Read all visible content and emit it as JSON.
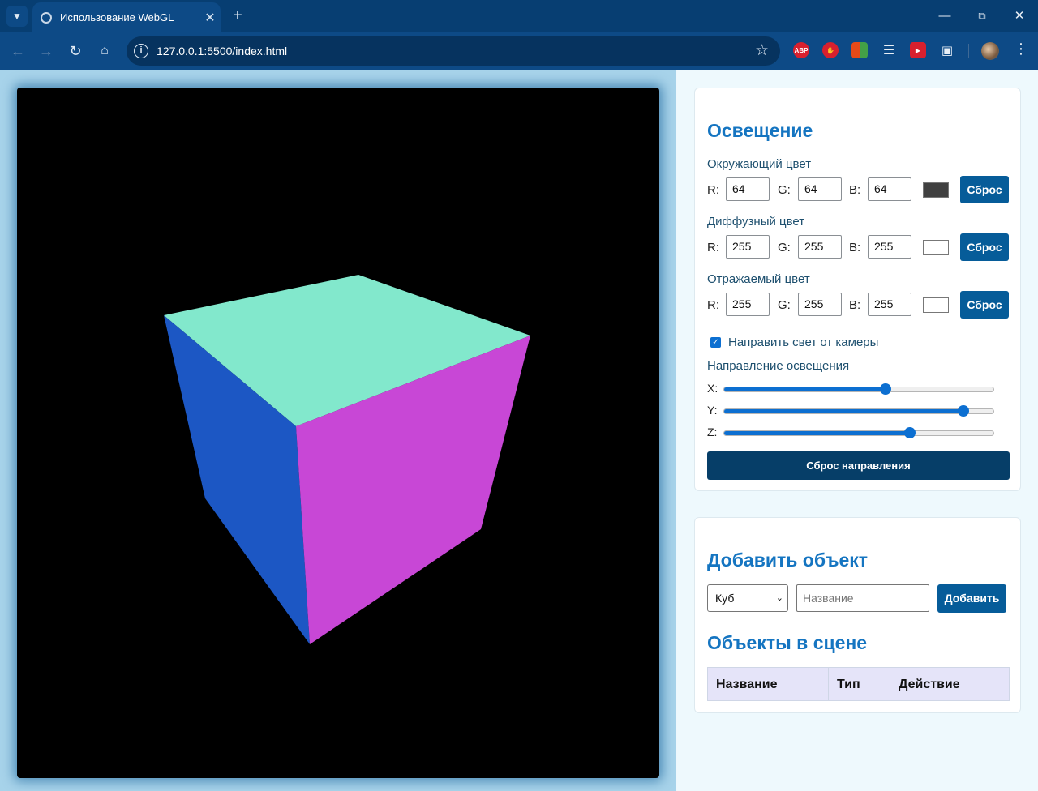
{
  "browser": {
    "tab_title": "Использование WebGL",
    "url": "127.0.0.1:5500/index.html",
    "extensions": [
      "ABP",
      "block-icon",
      "office-icon",
      "database-icon",
      "media-icon",
      "puzzle-icon"
    ]
  },
  "lighting": {
    "title": "Освещение",
    "ambient": {
      "label": "Окружающий цвет",
      "r": "64",
      "g": "64",
      "b": "64",
      "color": "#404040",
      "reset_label": "Сброс"
    },
    "diffuse": {
      "label": "Диффузный цвет",
      "r": "255",
      "g": "255",
      "b": "255",
      "color": "#ffffff",
      "reset_label": "Сброс"
    },
    "specular": {
      "label": "Отражаемый цвет",
      "r": "255",
      "g": "255",
      "b": "255",
      "color": "#ffffff",
      "reset_label": "Сброс"
    },
    "channel_labels": {
      "r": "R:",
      "g": "G:",
      "b": "B:"
    },
    "light_from_camera": {
      "label": "Направить свет от камеры",
      "checked": true
    },
    "direction": {
      "label": "Направление освещения",
      "x": {
        "label": "X:",
        "value_fraction": 0.6
      },
      "y": {
        "label": "Y:",
        "value_fraction": 0.885
      },
      "z": {
        "label": "Z:",
        "value_fraction": 0.69
      }
    },
    "reset_direction_label": "Сброс направления"
  },
  "add_object": {
    "title": "Добавить объект",
    "type_selected": "Куб",
    "name_placeholder": "Название",
    "add_label": "Добавить"
  },
  "scene_objects": {
    "title": "Объекты в сцене",
    "columns": [
      "Название",
      "Тип",
      "Действие"
    ],
    "rows": []
  },
  "cube_colors": {
    "top": "#82e8cc",
    "left": "#1c57c4",
    "right": "#c847d6"
  }
}
